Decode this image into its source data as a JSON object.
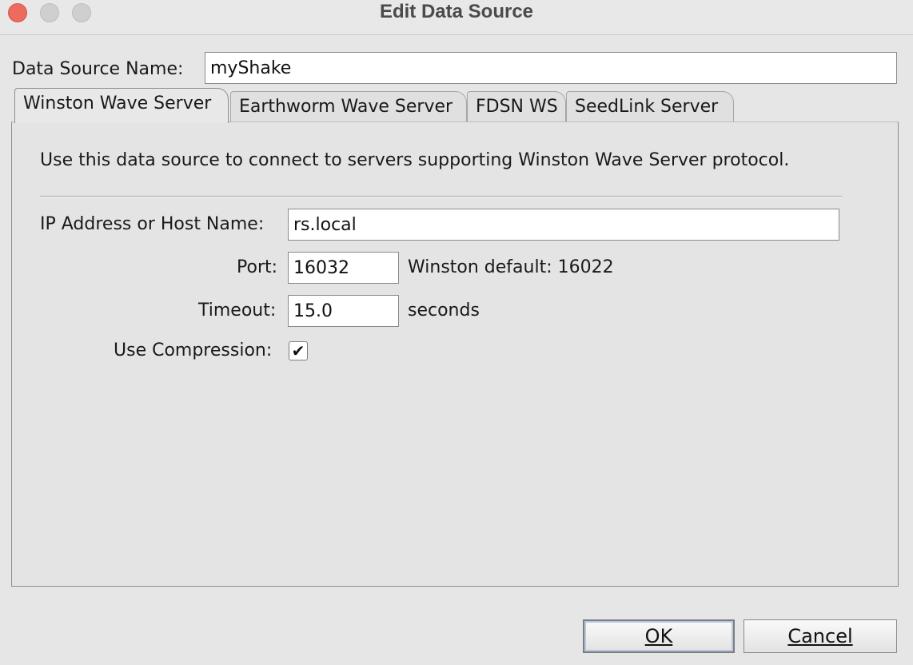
{
  "window": {
    "title": "Edit Data Source"
  },
  "name_field": {
    "label": "Data Source Name:",
    "value": "myShake"
  },
  "tabs": [
    {
      "label": "Winston Wave Server",
      "active": true
    },
    {
      "label": "Earthworm Wave Server",
      "active": false
    },
    {
      "label": "FDSN WS",
      "active": false
    },
    {
      "label": "SeedLink Server",
      "active": false
    }
  ],
  "panel": {
    "description": "Use this data source to connect to servers supporting Winston Wave Server protocol.",
    "host": {
      "label": "IP Address or Host Name:",
      "value": "rs.local"
    },
    "port": {
      "label": "Port:",
      "value": "16032",
      "hint": "Winston default: 16022"
    },
    "timeout": {
      "label": "Timeout:",
      "value": "15.0",
      "unit": "seconds"
    },
    "compression": {
      "label": "Use Compression:",
      "checked": true
    }
  },
  "buttons": {
    "ok": "OK",
    "cancel": "Cancel"
  }
}
